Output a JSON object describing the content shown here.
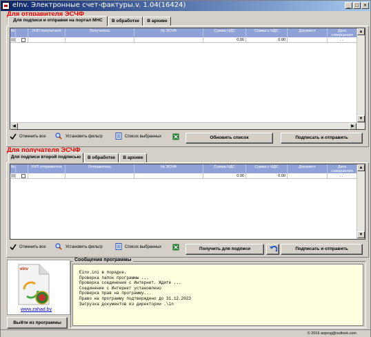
{
  "window": {
    "title": "eInv. Электронные счет-фактуры.v. 1.04(16424)",
    "min_glyph": "_",
    "max_glyph": "□",
    "close_glyph": "×"
  },
  "sender": {
    "section_title": "Для отправителя ЭСЧФ",
    "tabs": [
      "Для подписи и отправки на портал МНС",
      "В обработке",
      "В архиве"
    ],
    "columns": [
      "№",
      "УНП получателя",
      "Получатель",
      "№ ЭСЧФ",
      "Сумма НДС",
      "Сумма с НДС",
      "Документ",
      "Дата совершения"
    ],
    "row": {
      "vat": "0.00",
      "total": "0.00",
      "date": ". ."
    },
    "toolbar": {
      "deselect_all": "Отменить все",
      "set_filter": "Установить фильтр",
      "selected_list": "Список выбранных",
      "refresh_button": "Обновить список",
      "sign_send_button": "Подписать и отправить"
    }
  },
  "receiver": {
    "section_title": "Для получателя ЭСЧФ",
    "tabs": [
      "Для подписи второй подписью",
      "В обработке",
      "В архиве"
    ],
    "columns": [
      "№",
      "УНП отправителя",
      "Отправитель",
      "№ ЭСЧФ",
      "Сумма НДС",
      "Сумма с НДС",
      "Документ",
      "Дата совершения"
    ],
    "row": {
      "vat": "0.00",
      "total": "0.00",
      "date": ". ."
    },
    "toolbar": {
      "deselect_all": "Отменить все",
      "set_filter": "Установить фильтр",
      "selected_list": "Список выбранных",
      "get_for_sign_button": "Получить для подписи",
      "sign_send_button": "Подписать и отправить"
    }
  },
  "logo": {
    "doc_label": "eInv",
    "link": "www.zahad.by"
  },
  "exit_button": "Выйти из программы",
  "messages": {
    "title": "Сообщения программы",
    "lines": [
      "Einv.ini в порядке.",
      "Проверка папок программы ...",
      "Проверка соединения с Интернет. Ждите ...",
      "Соединение с Интернет установлено",
      "Проверка прав на программу...",
      "Право на программу подтверждено до 31.12.2023",
      "Загрузка документов из директории .\\in"
    ]
  },
  "status": {
    "copyright": "© 2016 avprog@outlook.com"
  },
  "colors": {
    "accent_red": "#e00000",
    "grid_header": "#8ea2d8",
    "title_bar": "#0a246a",
    "message_bg": "#ffffe0",
    "link": "#0000cc"
  }
}
